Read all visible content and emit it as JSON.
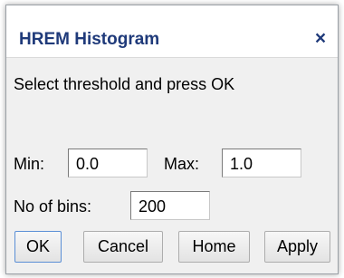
{
  "window": {
    "title": "HREM Histogram",
    "close_glyph": "×"
  },
  "prompt": "Select threshold and press OK",
  "fields": {
    "min_label": "Min:",
    "min_value": "0.0",
    "max_label": "Max:",
    "max_value": "1.0",
    "bins_label": "No of bins:",
    "bins_value": "200"
  },
  "buttons": {
    "ok": "OK",
    "cancel": "Cancel",
    "home": "Home",
    "apply": "Apply"
  },
  "colors": {
    "title": "#1f3a7a",
    "dialog_bg": "#f0f0f0",
    "titlebar_bg": "#ffffff"
  }
}
